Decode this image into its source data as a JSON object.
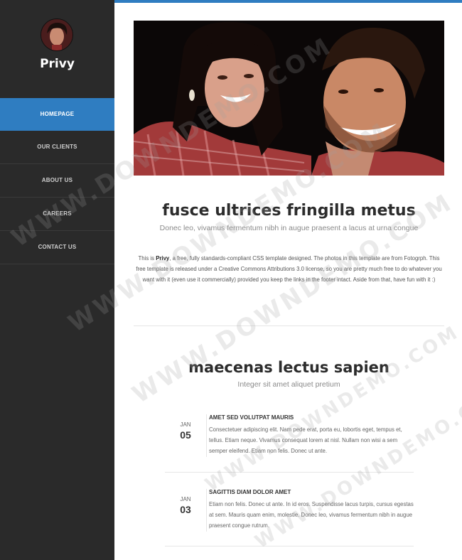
{
  "brand": {
    "name": "Privy"
  },
  "nav": {
    "items": [
      "HOMEPAGE",
      "OUR CLIENTS",
      "ABOUT US",
      "CAREERS",
      "CONTACT US"
    ]
  },
  "section1": {
    "title": "fusce ultrices fringilla metus",
    "subtitle": "Donec leo, vivamus fermentum nibh in augue praesent a lacus at urna congue",
    "intro_pre": "This is ",
    "intro_bold": "Privy",
    "intro_post": ", a free, fully standards-compliant CSS template designed. The photos in this template are from Fotogrph. This free template is released under a Creative Commons Attributions 3.0 license, so you are pretty much free to do whatever you want with it (even use it commercially) provided you keep the links in the footer intact. Aside from that, have fun with it :)"
  },
  "section2": {
    "title": "maecenas lectus sapien",
    "subtitle": "Integer sit amet aliquet pretium",
    "posts": [
      {
        "month": "JAN",
        "day": "05",
        "title": "AMET SED VOLUTPAT MAURIS",
        "body": "Consectetuer adipiscing elit. Nam pede erat, porta eu, lobortis eget, tempus et, tellus. Etiam neque. Vivamus consequat lorem at nisl. Nullam non wisi a sem semper eleifend. Etiam non felis. Donec ut ante."
      },
      {
        "month": "JAN",
        "day": "03",
        "title": "SAGITTIS DIAM DOLOR AMET",
        "body": "Etiam non felis. Donec ut ante. In id eros. Suspendisse lacus turpis, cursus egestas at sem. Mauris quam enim, molestie. Donec leo, vivamus fermentum nibh in augue praesent congue rutrum."
      }
    ]
  },
  "watermark": {
    "text": "WWW.DOWNDEMO.COM"
  },
  "colors": {
    "accent": "#2f7dc1",
    "sidebar": "#2a2a2a"
  }
}
